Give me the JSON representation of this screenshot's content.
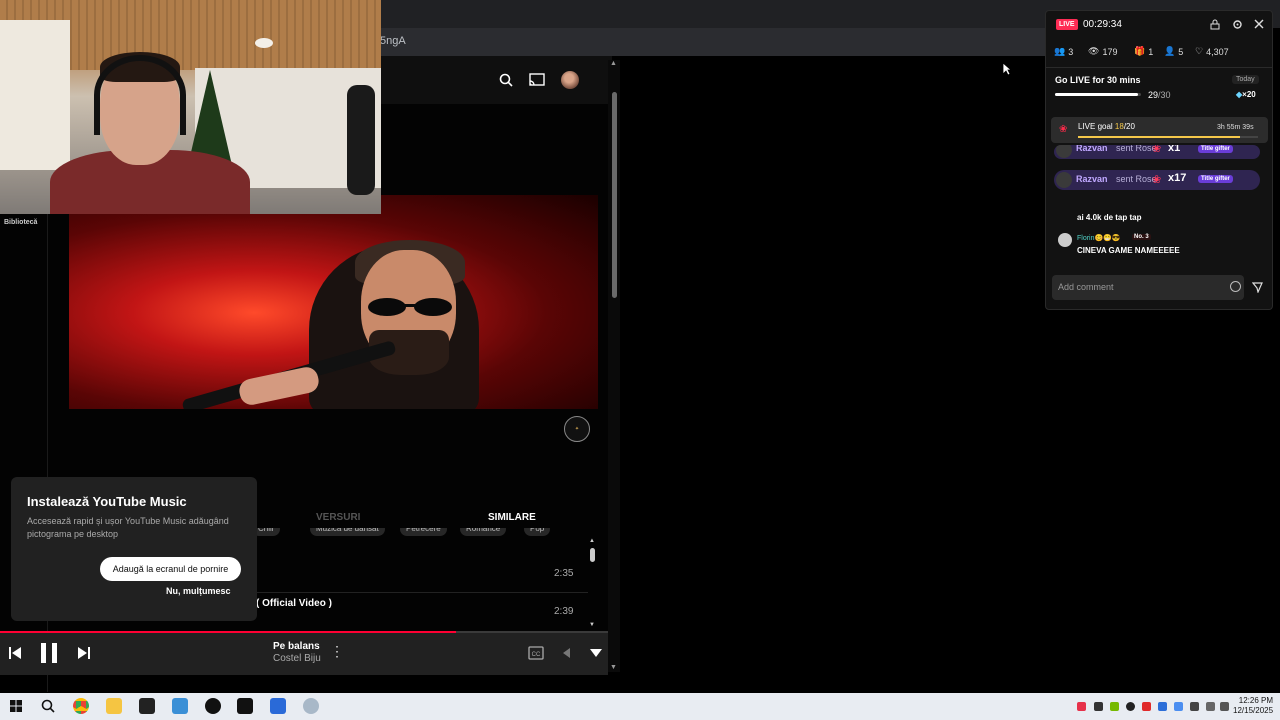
{
  "browser": {
    "url_fragment": "5ngA"
  },
  "yt_nav": {
    "library_label": "Bibliotecă"
  },
  "tabs": {
    "lyrics": "VERSURI",
    "related": "SIMILARE"
  },
  "chips": [
    "Chill",
    "Petrecere",
    "Muzică de dansat",
    "Ofertă",
    "Romance",
    "Pop"
  ],
  "list": {
    "row1_duration": "2:35",
    "row2_title": "( Official Video )",
    "row2_duration": "2:39"
  },
  "install_popup": {
    "title": "Instalează YouTube Music",
    "description": "Accesează rapid și ușor YouTube Music adăugând pictograma pe desktop",
    "add_button": "Adaugă la ecranul de pornire",
    "dismiss_button": "Nu, mulțumesc"
  },
  "player": {
    "title": "Pe balans",
    "artist": "Costel Biju",
    "progress_fraction": 0.75
  },
  "live_panel": {
    "badge": "LIVE",
    "timer": "00:29:34",
    "stats": {
      "viewers_joined": "3",
      "views": "179",
      "gifts": "1",
      "followers": "5",
      "likes": "4,307"
    },
    "go_live": {
      "label": "Go LIVE for 30 mins",
      "today": "Today",
      "progress_done": "29",
      "progress_total": "/30",
      "progress_fraction": 0.9667,
      "reward": "×20"
    },
    "goal": {
      "label_prefix": "LIVE goal ",
      "current": "18",
      "total": "/20",
      "progress_fraction": 0.9,
      "time_left": "3h 55m 39s"
    },
    "gifts": [
      {
        "user": "Razvan",
        "text": "sent Rose",
        "multiplier": "x1",
        "badge": "Title gifter"
      },
      {
        "user": "Razvan",
        "text": "sent Rose",
        "multiplier": "x17",
        "badge": "Title gifter"
      }
    ],
    "chat": [
      {
        "user": "",
        "message": "ai 4.0k de tap tap"
      },
      {
        "user": "Florin😊😁😎",
        "badge": "No. 3",
        "message": "CINEVA GAME NAMEEEEE"
      }
    ],
    "comment_placeholder": "Add comment"
  },
  "taskbar": {
    "time": "12:26 PM",
    "date": "12/15/2025"
  },
  "colors": {
    "accent_red": "#ff0033",
    "tiktok_pink": "#fe2c55",
    "gift_purple": "#6a3dd8"
  }
}
